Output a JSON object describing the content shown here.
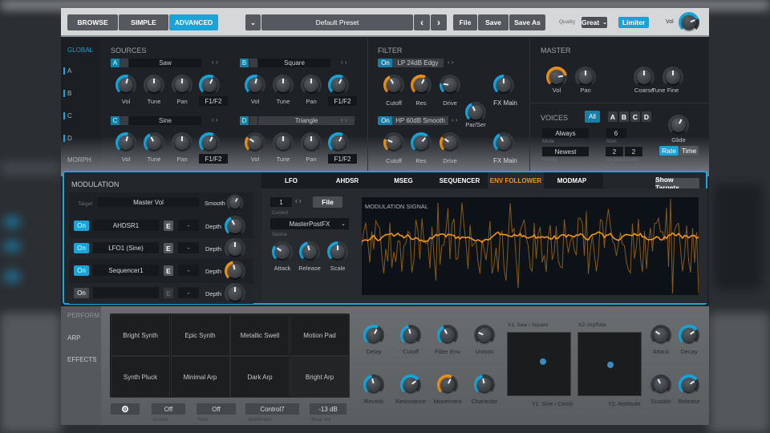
{
  "topbar": {
    "browse": "BROWSE",
    "simple": "SIMPLE",
    "advanced": "ADVANCED",
    "preset_chevron": "⌄",
    "preset": "Default Preset",
    "prev": "‹",
    "next": "›",
    "file": "File",
    "save": "Save",
    "save_as": "Save As",
    "quality_label": "Quality",
    "quality": "Great",
    "limiter": "Limiter",
    "vol_label": "Vol",
    "vol": {
      "value": 0.75,
      "color": "#19a3d8"
    }
  },
  "nav": {
    "global": "GLOBAL",
    "a": "A",
    "b": "B",
    "c": "C",
    "d": "D",
    "morph": "MORPH"
  },
  "sources": {
    "title": "SOURCES",
    "a": {
      "badge": "A",
      "name": "Saw",
      "arrows": "‹ ›",
      "knobs": [
        {
          "label": "Vol",
          "value": 0.55,
          "color": "#19a3d8"
        },
        {
          "label": "Tune",
          "value": 0.5,
          "color": "#3a3f45"
        },
        {
          "label": "Pan",
          "value": 0.5,
          "color": "#3a3f45"
        },
        {
          "label": "F1/F2",
          "value": 0.6,
          "color": "#19a3d8"
        }
      ],
      "f_dd": "F1/F2"
    },
    "b": {
      "badge": "B",
      "name": "Square",
      "arrows": "‹ ›",
      "knobs": [
        {
          "label": "Vol",
          "value": 0.55,
          "color": "#19a3d8"
        },
        {
          "label": "Tune",
          "value": 0.5,
          "color": "#3a3f45"
        },
        {
          "label": "Pan",
          "value": 0.5,
          "color": "#3a3f45"
        },
        {
          "label": "F1/F2",
          "value": 0.6,
          "color": "#19a3d8"
        }
      ],
      "f_dd": "F1/F2"
    },
    "c": {
      "badge": "C",
      "name": "Sine",
      "arrows": "‹ ›",
      "knobs": [
        {
          "label": "Vol",
          "value": 0.55,
          "color": "#19a3d8"
        },
        {
          "label": "Tune",
          "value": 0.4,
          "color": "#19a3d8"
        },
        {
          "label": "Pan",
          "value": 0.5,
          "color": "#3a3f45"
        },
        {
          "label": "F1/F2",
          "value": 0.6,
          "color": "#19a3d8"
        }
      ],
      "f_dd": "F1/F2"
    },
    "d": {
      "badge": "D",
      "name": "Triangle",
      "arrows": "‹ ›",
      "knobs": [
        {
          "label": "Vol",
          "value": 0.3,
          "color": "#e8901a"
        },
        {
          "label": "Tune",
          "value": 0.5,
          "color": "#3a3f45"
        },
        {
          "label": "Pan",
          "value": 0.5,
          "color": "#3a3f45"
        },
        {
          "label": "F1/F2",
          "value": 0.6,
          "color": "#19a3d8"
        }
      ],
      "f_dd": "F1/F2"
    }
  },
  "filter": {
    "title": "FILTER",
    "f1": {
      "on": "On",
      "type": "LP 24dB Edgy",
      "arrows": "‹ ›",
      "knobs": [
        {
          "label": "Cutoff",
          "value": 0.4,
          "color": "#e8901a"
        },
        {
          "label": "Res",
          "value": 0.6,
          "color": "#e8901a"
        },
        {
          "label": "Drive",
          "value": 0.2,
          "color": "#19a3d8"
        }
      ],
      "fx": {
        "value": 0.5,
        "color": "#19a3d8"
      },
      "fx_dd": "FX Main"
    },
    "parser": {
      "label": "Par/Ser",
      "value": 0.4,
      "color": "#19a3d8"
    },
    "f2": {
      "on": "On",
      "type": "HP 60dB Smooth",
      "arrows": "‹ ›",
      "knobs": [
        {
          "label": "Cutoff",
          "value": 0.25,
          "color": "#e8901a"
        },
        {
          "label": "Res",
          "value": 0.65,
          "color": "#19a3d8"
        },
        {
          "label": "Drive",
          "value": 0.3,
          "color": "#e8901a"
        }
      ],
      "fx": {
        "value": 0.4,
        "color": "#19a3d8"
      },
      "fx_dd": "FX Main"
    }
  },
  "master": {
    "title": "MASTER",
    "knobs": [
      {
        "label": "Vol",
        "value": 0.8,
        "color": "#e8901a"
      },
      {
        "label": "Pan",
        "value": 0.5,
        "color": "#3a3f45"
      },
      {
        "label": "Coarse",
        "value": 0.5,
        "color": "#3a3f45"
      },
      {
        "label": "Fine",
        "value": 0.5,
        "color": "#3a3f45"
      }
    ],
    "tune_label": "Tune"
  },
  "voices": {
    "title": "VOICES",
    "all": "All",
    "groups": [
      "A",
      "B",
      "C",
      "D"
    ],
    "mode": "Always",
    "mode_label": "Mode",
    "num": "6",
    "num_label": "Num",
    "priority": "Newest",
    "priority_label": "Priority",
    "up": "2",
    "down": "2",
    "bend_label": "Up Bend Down",
    "glide": {
      "label": "Glide",
      "value": 0.6,
      "color": "#3a3f45"
    },
    "rate": "Rate",
    "time": "Time"
  },
  "modulation": {
    "title": "MODULATION",
    "target_label": "Target",
    "target": "Master Vol",
    "smooth_label": "Smooth",
    "smooth": {
      "value": 0.6,
      "color": "#3a3f45"
    },
    "rows": [
      {
        "on": "On",
        "source": "AHDSR1",
        "e": "E",
        "mode": "-",
        "depth_label": "Depth",
        "depth": {
          "value": 0.4,
          "color": "#19a3d8"
        }
      },
      {
        "on": "On",
        "source": "LFO1 (Sine)",
        "e": "E",
        "mode": "-",
        "depth_label": "Depth",
        "depth": {
          "value": 0.5,
          "color": "#3a3f45"
        }
      },
      {
        "on": "On",
        "source": "Sequencer1",
        "e": "E",
        "mode": "-",
        "depth_label": "Depth",
        "depth": {
          "value": 0.45,
          "color": "#e8901a"
        }
      },
      {
        "on": "On",
        "source": "",
        "e": "E",
        "mode": "-",
        "depth_label": "Depth",
        "depth": {
          "value": 0.5,
          "color": "#3a3f45"
        }
      }
    ],
    "tabs": [
      "LFO",
      "AHDSR",
      "MSEG",
      "SEQUENCER",
      "ENV FOLLOWER",
      "MODMAP"
    ],
    "active_tab": "ENV FOLLOWER",
    "show_targets": "Show Targets",
    "env": {
      "index": "1",
      "arrows": "‹ ›",
      "file": "File",
      "current_label": "Current",
      "source": "MasterPostFX",
      "source_label": "Source",
      "knobs": [
        {
          "label": "Attack",
          "value": 0.3,
          "color": "#19a3d8"
        },
        {
          "label": "Release",
          "value": 0.45,
          "color": "#19a3d8"
        },
        {
          "label": "Scale",
          "value": 0.5,
          "color": "#19a3d8"
        }
      ],
      "signal_label": "MODULATION SIGNAL",
      "signal_color": "#f0960f"
    }
  },
  "perform": {
    "nav": [
      "PERFORM",
      "ARP",
      "EFFECTS"
    ],
    "pads": [
      "Bright Synth",
      "Epic Synth",
      "Metallic Swell",
      "Motion Pad",
      "Synth Pluck",
      "Minimal Arp",
      "Dark Arp",
      "Bright Arp"
    ],
    "controls": {
      "octave": "Off",
      "octave_label": "Octave",
      "rate": "Off",
      "rate_label": "Rate",
      "modwheel": "Control7",
      "modwheel_label": "ModWheel",
      "snap_vol": "-13 dB",
      "snap_vol_label": "Snap Vol"
    },
    "knobs": [
      {
        "label": "Delay",
        "value": 0.6,
        "color": "#19a3d8"
      },
      {
        "label": "Cutoff",
        "value": 0.45,
        "color": "#19a3d8"
      },
      {
        "label": "Filter Env",
        "value": 0.4,
        "color": "#19a3d8"
      },
      {
        "label": "Unison",
        "value": 0.25,
        "color": "#3a3f45"
      },
      {
        "label": "Reverb",
        "value": 0.45,
        "color": "#19a3d8"
      },
      {
        "label": "Resonance",
        "value": 0.7,
        "color": "#19a3d8"
      },
      {
        "label": "Movement",
        "value": 0.6,
        "color": "#e8901a"
      },
      {
        "label": "Character",
        "value": 0.45,
        "color": "#19a3d8"
      }
    ],
    "xy1": {
      "x_label": "X1: Saw / Square",
      "y_label": "Y1: Sine / Comb"
    },
    "xy2": {
      "x_label": "X2: ArpRate",
      "y_label": "Y2: ArpMode"
    },
    "env_knobs": [
      {
        "label": "Attack",
        "value": 0.3,
        "color": "#3a3f45"
      },
      {
        "label": "Decay",
        "value": 0.7,
        "color": "#19a3d8"
      },
      {
        "label": "Sustain",
        "value": 0.4,
        "color": "#3a3f45"
      },
      {
        "label": "Release",
        "value": 0.7,
        "color": "#19a3d8"
      }
    ]
  }
}
